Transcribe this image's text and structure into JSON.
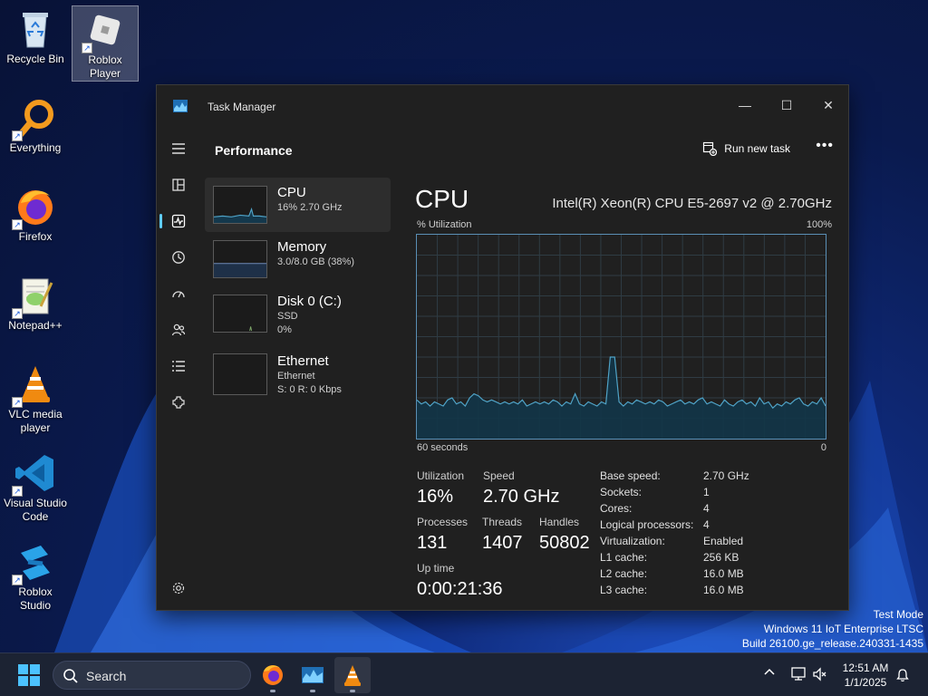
{
  "desktop": {
    "icons": [
      {
        "label": "Recycle Bin",
        "icon": "recycle-bin-icon"
      },
      {
        "label": "Roblox Player",
        "icon": "roblox-player-icon",
        "selected": true
      },
      {
        "label": "Everything",
        "icon": "everything-search-icon"
      },
      {
        "label": "Firefox",
        "icon": "firefox-icon"
      },
      {
        "label": "Notepad++",
        "icon": "notepadpp-icon"
      },
      {
        "label": "VLC media player",
        "icon": "vlc-icon"
      },
      {
        "label": "Visual Studio Code",
        "icon": "vscode-icon"
      },
      {
        "label": "Roblox Studio",
        "icon": "roblox-studio-icon"
      }
    ],
    "watermark": {
      "line1": "Test Mode",
      "line2": "Windows 11 IoT Enterprise LTSC",
      "line3": "Build 26100.ge_release.240331-1435"
    }
  },
  "task_manager": {
    "title": "Task Manager",
    "section_title": "Performance",
    "run_new_task": "Run new task",
    "more": "•••",
    "window_buttons": {
      "minimize": "—",
      "maximize": "☐",
      "close": "✕"
    },
    "resources": [
      {
        "name": "CPU",
        "line1": "16%  2.70 GHz",
        "line2": ""
      },
      {
        "name": "Memory",
        "line1": "3.0/8.0 GB (38%)",
        "line2": ""
      },
      {
        "name": "Disk 0 (C:)",
        "line1": "SSD",
        "line2": "0%"
      },
      {
        "name": "Ethernet",
        "line1": "Ethernet",
        "line2": "S: 0 R: 0 Kbps"
      }
    ],
    "detail": {
      "heading": "CPU",
      "model": "Intel(R) Xeon(R) CPU E5-2697 v2 @ 2.70GHz",
      "util_label": "% Utilization",
      "util_max": "100%",
      "time_label": "60 seconds",
      "time_end": "0",
      "stats": {
        "utilization_label": "Utilization",
        "utilization": "16%",
        "speed_label": "Speed",
        "speed": "2.70 GHz",
        "processes_label": "Processes",
        "processes": "131",
        "threads_label": "Threads",
        "threads": "1407",
        "handles_label": "Handles",
        "handles": "50802",
        "uptime_label": "Up time",
        "uptime": "0:00:21:36"
      },
      "specs": [
        {
          "k": "Base speed:",
          "v": "2.70 GHz"
        },
        {
          "k": "Sockets:",
          "v": "1"
        },
        {
          "k": "Cores:",
          "v": "4"
        },
        {
          "k": "Logical processors:",
          "v": "4"
        },
        {
          "k": "Virtualization:",
          "v": "Enabled"
        },
        {
          "k": "L1 cache:",
          "v": "256 KB"
        },
        {
          "k": "L2 cache:",
          "v": "16.0 MB"
        },
        {
          "k": "L3 cache:",
          "v": "16.0 MB"
        }
      ]
    },
    "cpu_history_percent": [
      19,
      17,
      18,
      16,
      18,
      17,
      16,
      19,
      20,
      17,
      18,
      16,
      20,
      22,
      21,
      19,
      18,
      19,
      18,
      17,
      18,
      17,
      18,
      17,
      19,
      16,
      17,
      18,
      17,
      18,
      17,
      19,
      18,
      16,
      18,
      17,
      22,
      17,
      16,
      18,
      17,
      16,
      18,
      17,
      40,
      40,
      18,
      16,
      18,
      17,
      19,
      18,
      17,
      18,
      17,
      19,
      18,
      16,
      17,
      18,
      19,
      17,
      18,
      17,
      19,
      20,
      17,
      18,
      17,
      16,
      19,
      17,
      16,
      18,
      19,
      17,
      18,
      16,
      20,
      17,
      18,
      15,
      17,
      16,
      18,
      17,
      19,
      20,
      17,
      16,
      18,
      17,
      20,
      16
    ]
  },
  "taskbar": {
    "search_placeholder": "Search",
    "time": "12:51 AM",
    "date": "1/1/2025"
  },
  "colors": {
    "accent": "#60cdff",
    "graph_line": "#4fa3c7",
    "graph_fill": "#123548",
    "window_bg": "#202020"
  }
}
